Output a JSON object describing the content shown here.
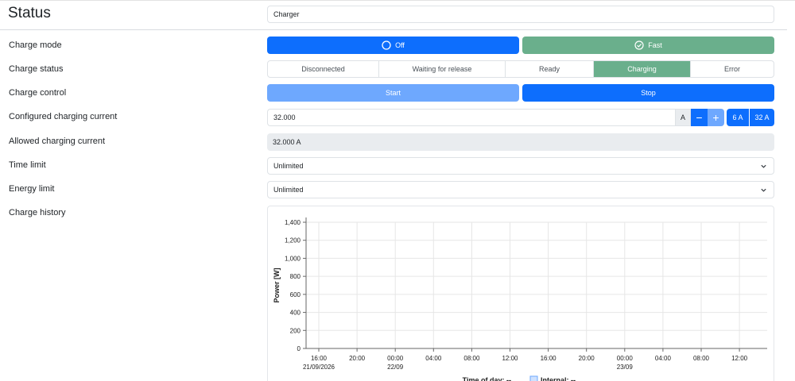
{
  "header": {
    "title": "Status",
    "charger_name": "Charger"
  },
  "charge_mode": {
    "label": "Charge mode",
    "options": [
      {
        "label": "Off",
        "icon": "circle-icon",
        "state": "selected"
      },
      {
        "label": "Fast",
        "icon": "check-circle-icon",
        "state": "unselected"
      }
    ]
  },
  "charge_status": {
    "label": "Charge status",
    "states": [
      "Disconnected",
      "Waiting for release",
      "Ready",
      "Charging",
      "Error"
    ],
    "active": "Charging"
  },
  "charge_control": {
    "label": "Charge control",
    "start_label": "Start",
    "stop_label": "Stop"
  },
  "configured_current": {
    "label": "Configured charging current",
    "value": "32.000",
    "unit": "A",
    "minus": "−",
    "plus": "+",
    "preset_min": "6 A",
    "preset_max": "32 A"
  },
  "allowed_current": {
    "label": "Allowed charging current",
    "value": "32.000 A"
  },
  "time_limit": {
    "label": "Time limit",
    "value": "Unlimited"
  },
  "energy_limit": {
    "label": "Energy limit",
    "value": "Unlimited"
  },
  "charge_history": {
    "label": "Charge history"
  },
  "colors": {
    "primary": "#0d6efd",
    "primary_light": "#6ea8fe",
    "success": "#6aaf8c",
    "readonly_bg": "#e9ecef",
    "grid": "#e6e6e6"
  },
  "chart_data": {
    "type": "line",
    "ylabel": "Power [W]",
    "xlabel": "Time of day: --",
    "ylim": [
      0,
      1400
    ],
    "y_ticks": [
      0,
      200,
      400,
      600,
      800,
      1000,
      1200,
      1400
    ],
    "y_tick_labels": [
      "0",
      "200",
      "400",
      "600",
      "800",
      "1,000",
      "1,200",
      "1,400"
    ],
    "x_ticks": [
      {
        "label": "16:00",
        "sub": "21/09/2026"
      },
      {
        "label": "20:00",
        "sub": ""
      },
      {
        "label": "00:00",
        "sub": "22/09"
      },
      {
        "label": "04:00",
        "sub": ""
      },
      {
        "label": "08:00",
        "sub": ""
      },
      {
        "label": "12:00",
        "sub": ""
      },
      {
        "label": "16:00",
        "sub": ""
      },
      {
        "label": "20:00",
        "sub": ""
      },
      {
        "label": "00:00",
        "sub": "23/09"
      },
      {
        "label": "04:00",
        "sub": ""
      },
      {
        "label": "08:00",
        "sub": ""
      },
      {
        "label": "12:00",
        "sub": ""
      }
    ],
    "grid": true,
    "legend_position": "bottom",
    "series": [
      {
        "name": "Internal: --",
        "color": "#6ea8fe",
        "values": []
      }
    ]
  }
}
